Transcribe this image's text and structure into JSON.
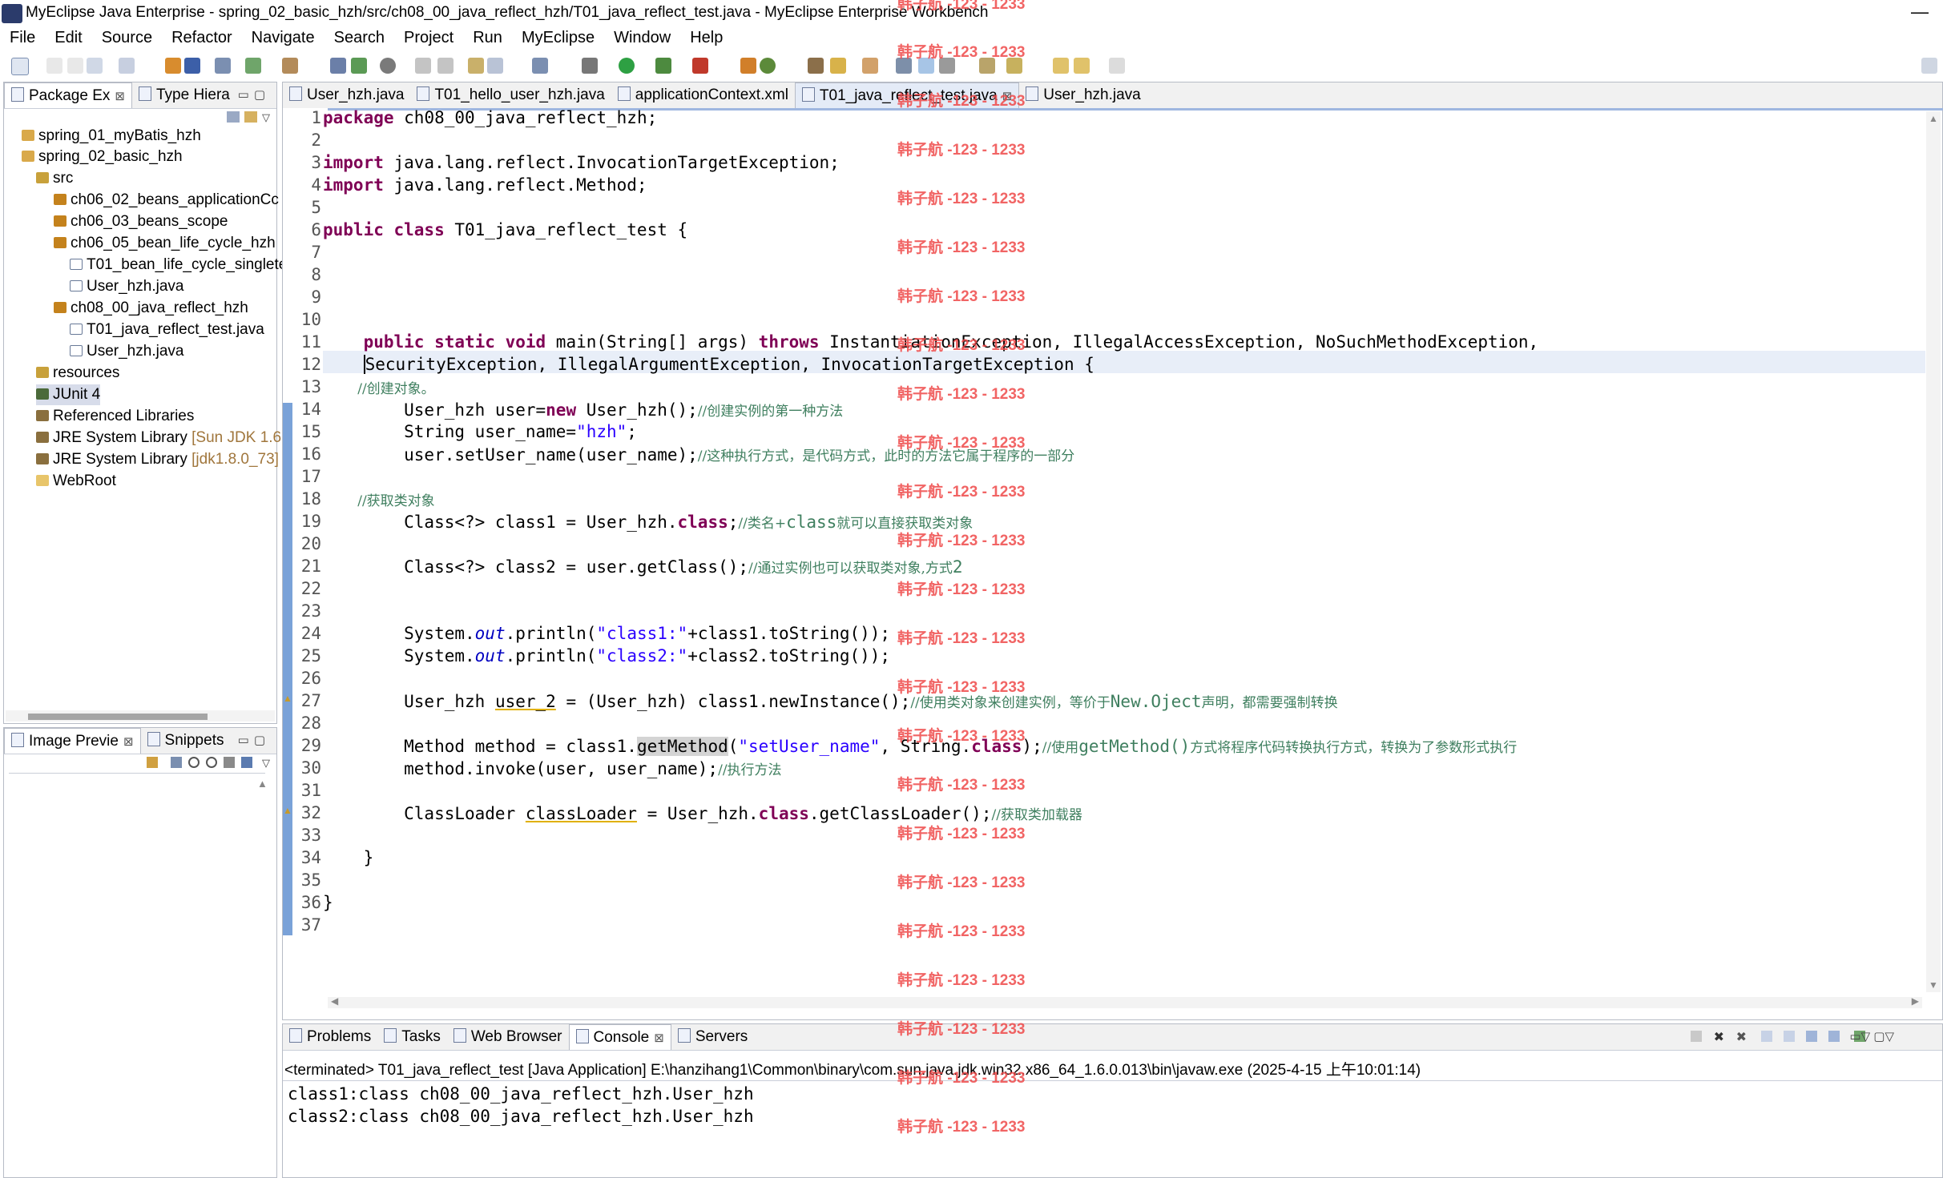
{
  "window": {
    "title": "MyEclipse Java Enterprise - spring_02_basic_hzh/src/ch08_00_java_reflect_hzh/T01_java_reflect_test.java - MyEclipse Enterprise Workbench",
    "minimize": "—"
  },
  "menu": [
    "File",
    "Edit",
    "Source",
    "Refactor",
    "Navigate",
    "Search",
    "Project",
    "Run",
    "MyEclipse",
    "Window",
    "Help"
  ],
  "left_panel": {
    "tabs": [
      {
        "label": "Package Ex",
        "close": "⊠"
      },
      {
        "label": "Type Hiera",
        "close": ""
      }
    ],
    "tree": [
      {
        "label": "spring_01_myBatis_hzh",
        "suffix": ""
      },
      {
        "label": "spring_02_basic_hzh",
        "suffix": ""
      },
      {
        "label": "src",
        "suffix": ""
      },
      {
        "label": "ch06_02_beans_applicationCc",
        "suffix": ""
      },
      {
        "label": "ch06_03_beans_scope",
        "suffix": ""
      },
      {
        "label": "ch06_05_bean_life_cycle_hzh",
        "suffix": ""
      },
      {
        "label": "T01_bean_life_cycle_singlete",
        "suffix": ""
      },
      {
        "label": "User_hzh.java",
        "suffix": ""
      },
      {
        "label": "ch08_00_java_reflect_hzh",
        "suffix": ""
      },
      {
        "label": "T01_java_reflect_test.java",
        "suffix": ""
      },
      {
        "label": "User_hzh.java",
        "suffix": ""
      },
      {
        "label": "resources",
        "suffix": ""
      },
      {
        "label": "JUnit 4",
        "suffix": ""
      },
      {
        "label": "Referenced Libraries",
        "suffix": ""
      },
      {
        "label": "JRE System Library",
        "suffix": "[Sun JDK 1.6."
      },
      {
        "label": "JRE System Library",
        "suffix": "[jdk1.8.0_73]"
      },
      {
        "label": "WebRoot",
        "suffix": ""
      }
    ]
  },
  "image_panel": {
    "tabs": [
      {
        "label": "Image Previe",
        "close": "⊠"
      },
      {
        "label": "Snippets",
        "close": ""
      }
    ]
  },
  "editor": {
    "tabs": [
      {
        "label": "User_hzh.java",
        "active": false
      },
      {
        "label": "T01_hello_user_hzh.java",
        "active": false
      },
      {
        "label": "applicationContext.xml",
        "active": false
      },
      {
        "label": "T01_java_reflect_test.java",
        "active": true
      },
      {
        "label": "User_hzh.java",
        "active": false
      }
    ],
    "tab_close": "⊠",
    "line_numbers": [
      "1",
      "2",
      "3",
      "4",
      "5",
      "6",
      "7",
      "8",
      "9",
      "10",
      "11",
      "12",
      "13",
      "14",
      "15",
      "16",
      "17",
      "18",
      "19",
      "20",
      "21",
      "22",
      "23",
      "24",
      "25",
      "26",
      "27",
      "28",
      "29",
      "30",
      "31",
      "32",
      "33",
      "34",
      "35",
      "36",
      "37"
    ],
    "code": {
      "l1_kw": "package",
      "l1_rest": " ch08_00_java_reflect_hzh;",
      "l3_kw": "import",
      "l3_rest": " java.lang.reflect.InvocationTargetException;",
      "l4_kw": "import",
      "l4_rest": " java.lang.reflect.Method;",
      "l6_kw": "public class",
      "l6_rest": " T01_java_reflect_test {",
      "l11_kw1": "    public static void",
      "l11_mid": " main(String[] args) ",
      "l11_kw2": "throws",
      "l11_rest": " InstantiationException, IllegalAccessException, NoSuchMethodException,",
      "l12_a": "    ",
      "l12_b": "SecurityException",
      "l12_c": ", IllegalArgumentException, InvocationTargetException {",
      "l13_cmt": "        //创建对象。",
      "l14_a": "        User_hzh user=",
      "l14_kw": "new",
      "l14_b": " User_hzh();",
      "l14_cmt": "//创建实例的第一种方法",
      "l15_a": "        String user_name=",
      "l15_str": "\"hzh\"",
      "l15_b": ";",
      "l16_a": "        user.setUser_name(user_name);",
      "l16_cmt": "//这种执行方式，是代码方式，此时的方法它属于程序的一部分",
      "l18_cmt": "        //获取类对象",
      "l19_a": "        Class<?> class1 = User_hzh.",
      "l19_kw": "class",
      "l19_b": ";",
      "l19_cmt1": "//类名+",
      "l19_cmt2": "class",
      "l19_cmt3": "就可以直接获取类对象",
      "l21_a": "        Class<?> class2 = user.getClass();",
      "l21_cmt1": "//通过实例也可以获取类对象,方式",
      "l21_cmt2": "2",
      "l24_a": "        System.",
      "l24_it": "out",
      "l24_b": ".println(",
      "l24_str": "\"class1:\"",
      "l24_c": "+class1.toString());",
      "l25_a": "        System.",
      "l25_it": "out",
      "l25_b": ".println(",
      "l25_str": "\"class2:\"",
      "l25_c": "+class2.toString());",
      "l27_a": "        User_hzh ",
      "l27_ul": "user_2",
      "l27_b": " = (User_hzh) class1.newInstance();",
      "l27_cmt1": "//使用类对象来创建实例，等价于",
      "l27_cmt2": "New.Oject",
      "l27_cmt3": "声明，都需要强制转换",
      "l29_a": "        Method method = class1.",
      "l29_m": "getMethod",
      "l29_b": "(",
      "l29_str": "\"setUser_name\"",
      "l29_c": ", String.",
      "l29_kw": "class",
      "l29_d": ");",
      "l29_cmt1": "//使用",
      "l29_cmt2": "getMethod()",
      "l29_cmt3": "方式将程序代码转换执行方式，转换为了参数形式执行",
      "l30_a": "        method.invoke(user, user_name);",
      "l30_cmt": "//执行方法",
      "l32_a": "        ClassLoader ",
      "l32_ul": "classLoader",
      "l32_b": " = User_hzh.",
      "l32_kw": "class",
      "l32_c": ".getClassLoader();",
      "l32_cmt": "//获取类加载器",
      "l34": "    }",
      "l36": "}"
    }
  },
  "bottom_panel": {
    "tabs": [
      {
        "label": "Problems",
        "close": ""
      },
      {
        "label": "Tasks",
        "close": ""
      },
      {
        "label": "Web Browser",
        "close": ""
      },
      {
        "label": "Console",
        "close": "⊠"
      },
      {
        "label": "Servers",
        "close": ""
      }
    ],
    "status": "<terminated> T01_java_reflect_test [Java Application] E:\\hanzihang1\\Common\\binary\\com.sun.java.jdk.win32.x86_64_1.6.0.013\\bin\\javaw.exe (2025-4-15 上午10:01:14)",
    "output": [
      "class1:class ch08_00_java_reflect_hzh.User_hzh",
      "class2:class ch08_00_java_reflect_hzh.User_hzh"
    ]
  },
  "watermark": "韩子航 -123 - 1233",
  "colors": {
    "keyword": "#7f0055",
    "string": "#2a00ff",
    "comment": "#3f7f5f",
    "field": "#0000c0",
    "watermark": "#ef4a4a"
  }
}
